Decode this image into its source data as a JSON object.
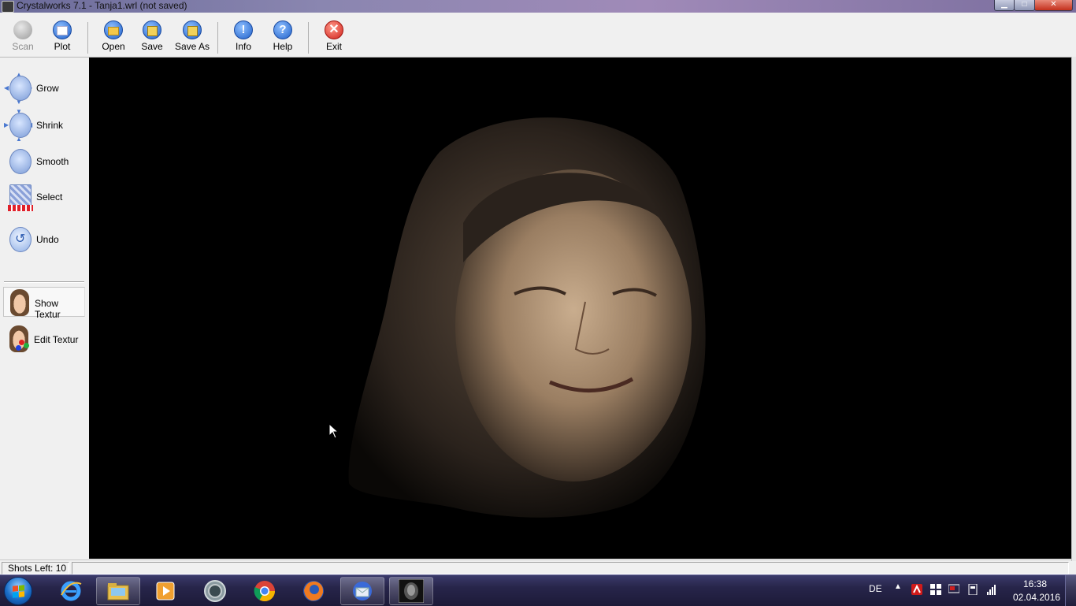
{
  "window": {
    "title": "Crystalworks 7.1 - Tanja1.wrl  (not saved)",
    "controls": {
      "minimize": "▁",
      "maximize": "□",
      "close": "✕"
    }
  },
  "toolbar": {
    "scan": "Scan",
    "plot": "Plot",
    "open": "Open",
    "save": "Save",
    "save_as": "Save As",
    "info": "Info",
    "help": "Help",
    "exit": "Exit"
  },
  "sidebar": {
    "grow": "Grow",
    "shrink": "Shrink",
    "smooth": "Smooth",
    "select": "Select",
    "undo": "Undo",
    "show_texture": "Show Textur",
    "edit_texture": "Edit Textur"
  },
  "status": {
    "shots_left": "Shots Left: 10"
  },
  "taskbar": {
    "language": "DE",
    "time": "16:38",
    "date": "02.04.2016",
    "tray_arrow": "▲"
  },
  "colors": {
    "accent_blue": "#1e5fc9",
    "exit_red": "#d0201a",
    "viewport_bg": "#000000"
  }
}
